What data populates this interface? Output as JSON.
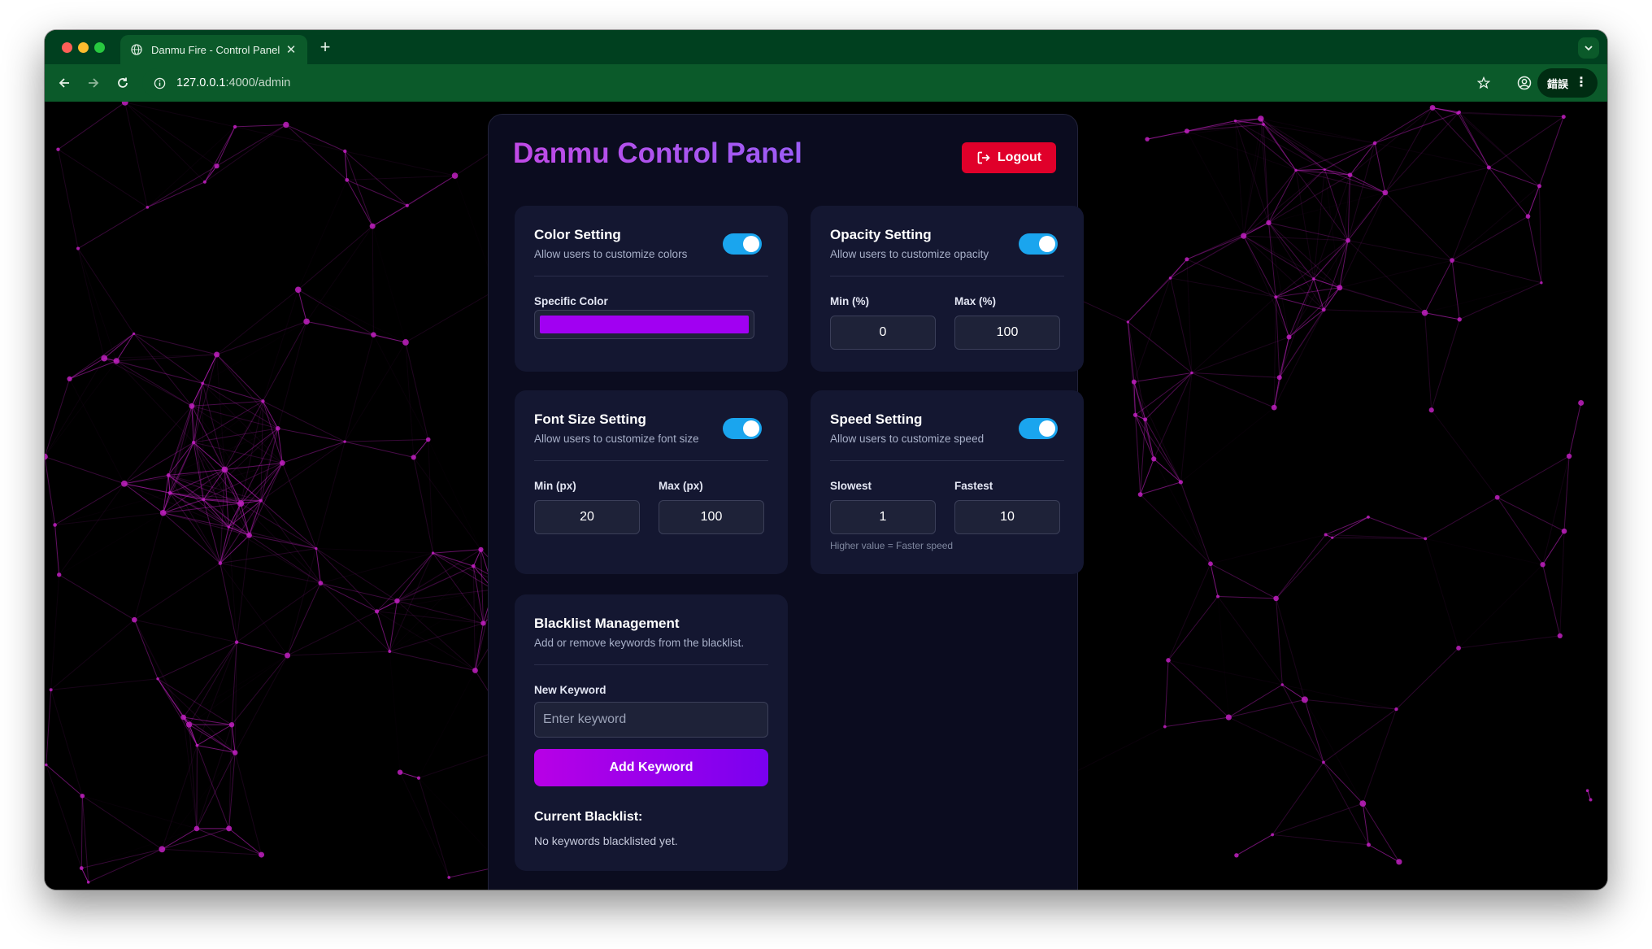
{
  "browser": {
    "tab_title": "Danmu Fire - Control Panel",
    "url_host": "127.0.0.1",
    "url_path": ":4000/admin",
    "error_label": "錯誤",
    "theme_color": "#0b5a2a"
  },
  "panel": {
    "title": "Danmu Control Panel",
    "logout_label": "Logout",
    "color_setting": {
      "title": "Color Setting",
      "description": "Allow users to customize colors",
      "enabled": true,
      "specific_color_label": "Specific Color",
      "specific_color": "#a100f2"
    },
    "opacity_setting": {
      "title": "Opacity Setting",
      "description": "Allow users to customize opacity",
      "enabled": true,
      "min_label": "Min (%)",
      "min_value": "0",
      "max_label": "Max (%)",
      "max_value": "100"
    },
    "font_size_setting": {
      "title": "Font Size Setting",
      "description": "Allow users to customize font size",
      "enabled": true,
      "min_label": "Min (px)",
      "min_value": "20",
      "max_label": "Max (px)",
      "max_value": "100"
    },
    "speed_setting": {
      "title": "Speed Setting",
      "description": "Allow users to customize speed",
      "enabled": true,
      "slowest_label": "Slowest",
      "slowest_value": "1",
      "fastest_label": "Fastest",
      "fastest_value": "10",
      "hint": "Higher value = Faster speed"
    },
    "blacklist": {
      "title": "Blacklist Management",
      "description": "Add or remove keywords from the blacklist.",
      "new_keyword_label": "New Keyword",
      "placeholder": "Enter keyword",
      "add_label": "Add Keyword",
      "current_label": "Current Blacklist:",
      "empty_text": "No keywords blacklisted yet."
    }
  },
  "colors": {
    "accent_toggle": "#1aa5ee",
    "logout": "#e0002a",
    "network_lines": "#c020c0"
  }
}
